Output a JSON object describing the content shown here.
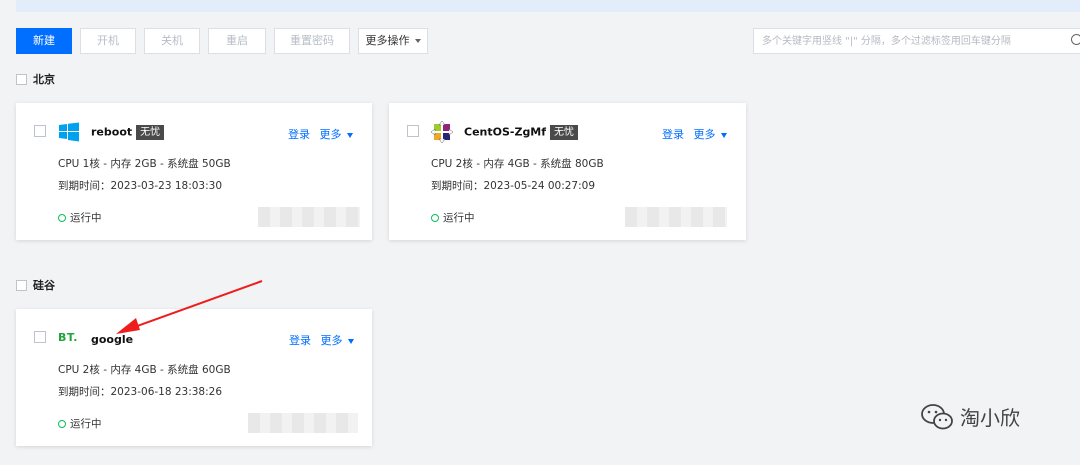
{
  "toolbar": {
    "new": "新建",
    "power_on": "开机",
    "power_off": "关机",
    "restart": "重启",
    "reset_password": "重置密码",
    "more_ops": "更多操作"
  },
  "search": {
    "placeholder": "多个关键字用竖线 \"|\" 分隔，多个过滤标签用回车键分隔"
  },
  "regions": [
    {
      "name": "北京",
      "instances": [
        {
          "name": "reboot",
          "badge": "无忧",
          "login": "登录",
          "more": "更多",
          "spec": "CPU 1核 - 内存 2GB - 系统盘 50GB",
          "expire": "到期时间：2023-03-23 18:03:30",
          "status": "运行中",
          "os_icon": "windows-icon"
        },
        {
          "name": "CentOS-ZgMf",
          "badge": "无忧",
          "login": "登录",
          "more": "更多",
          "spec": "CPU 2核 - 内存 4GB - 系统盘 80GB",
          "expire": "到期时间：2023-05-24 00:27:09",
          "status": "运行中",
          "os_icon": "centos-icon"
        }
      ]
    },
    {
      "name": "硅谷",
      "instances": [
        {
          "name": "google",
          "login": "登录",
          "more": "更多",
          "spec": "CPU 2核 - 内存 4GB - 系统盘 60GB",
          "expire": "到期时间：2023-06-18 23:38:26",
          "status": "运行中",
          "os_icon": "bt-panel-icon",
          "logo_text": "BT."
        }
      ]
    }
  ],
  "watermark": {
    "text": "淘小欣"
  },
  "colors": {
    "primary": "#006eff",
    "running": "#0abf5b",
    "badge": "#4a4a4a",
    "annotation_arrow": "#ee1c1c"
  }
}
